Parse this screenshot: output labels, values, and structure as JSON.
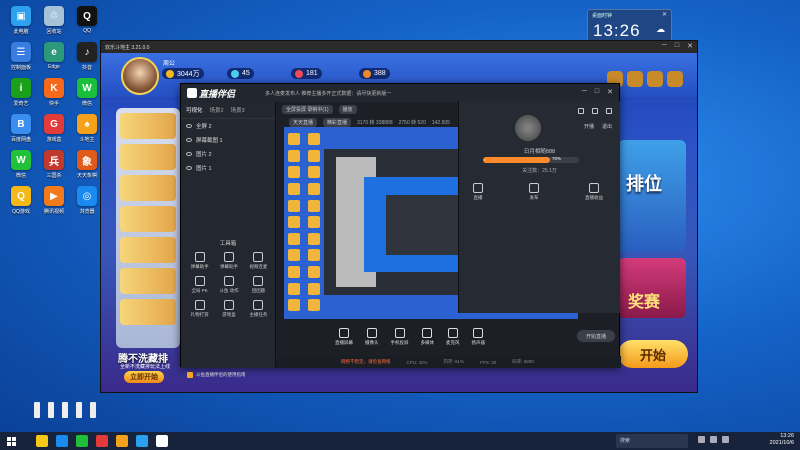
{
  "desktop": {
    "icons": [
      {
        "label": "此电脑",
        "color": "#2ea0f0",
        "glyph": "▣"
      },
      {
        "label": "回收站",
        "color": "#a6c2d8",
        "glyph": "♲"
      },
      {
        "label": "QQ",
        "color": "#111",
        "glyph": "Q"
      },
      {
        "label": "控制面板",
        "color": "#3a7de0",
        "glyph": "☰"
      },
      {
        "label": "Edge",
        "color": "#2c9a7a",
        "glyph": "e"
      },
      {
        "label": "抖音",
        "color": "#222",
        "glyph": "♪"
      },
      {
        "label": "爱奇艺",
        "color": "#1aa01a",
        "glyph": "i"
      },
      {
        "label": "快手",
        "color": "#f56a1a",
        "glyph": "K"
      },
      {
        "label": "微信",
        "color": "#1abf3a",
        "glyph": "W"
      },
      {
        "label": "百度网盘",
        "color": "#3a8ef0",
        "glyph": "B"
      },
      {
        "label": "游戏盒",
        "color": "#e33a3a",
        "glyph": "G"
      },
      {
        "label": "斗地主",
        "color": "#f5a11a",
        "glyph": "♠"
      },
      {
        "label": "微信",
        "color": "#22c13a",
        "glyph": "W"
      },
      {
        "label": "三国杀",
        "color": "#c0392b",
        "glyph": "兵"
      },
      {
        "label": "天天象棋",
        "color": "#e05a1a",
        "glyph": "象"
      },
      {
        "label": "QQ游戏",
        "color": "#f5b81a",
        "glyph": "Q"
      },
      {
        "label": "腾讯视频",
        "color": "#f27a1a",
        "glyph": "▶"
      },
      {
        "label": "浏览器",
        "color": "#1a8af0",
        "glyph": "◎"
      }
    ],
    "clock_widget": {
      "label": "桌面时钟",
      "time": "13:26",
      "close": "✕"
    }
  },
  "game_window": {
    "title": "欢乐斗地主 3.21.0.0",
    "player_label": "周公",
    "stats": [
      {
        "value": "3044万",
        "color": "#f5b81a"
      },
      {
        "value": "45",
        "color": "#4ad0f0"
      },
      {
        "value": "181",
        "color": "#f04a5a"
      },
      {
        "value": "388",
        "color": "#f08a2a"
      }
    ],
    "promo_title": "腾不洗藏排",
    "promo_sub": "全新不洗藏排玩法上线",
    "promo_button": "立即开始",
    "rank_label": "排位",
    "prize_label": "奖赛",
    "start_label": "开始"
  },
  "obs": {
    "logo": "直播伴侣",
    "notice": "多人连麦发布人 推荐主播多开正式数据：请尽快更新版一",
    "scene_tabs": [
      "可视化",
      "场景2",
      "场景3"
    ],
    "scenes": [
      "全屏 2",
      "屏幕截图 1",
      "图片 2",
      "图片 1"
    ],
    "tools_label": "工具箱",
    "tools": [
      {
        "label": "弹幕助手"
      },
      {
        "label": "弹幕助手"
      },
      {
        "label": "视频连麦"
      },
      {
        "label": "全局 PK"
      },
      {
        "label": "斗鱼 动作"
      },
      {
        "label": "团团题"
      },
      {
        "label": "礼物打赏"
      },
      {
        "label": "游戏盒"
      },
      {
        "label": "主播任务"
      }
    ],
    "tool_banner": "斗鱼直播伴侣的使用指南",
    "main_tabs": [
      "全屏投屏 录制中(1)",
      "播放"
    ],
    "main_tabs2": [
      "天天直播",
      "精彩直播"
    ],
    "stats_nums": [
      "3170 转 338888",
      "2750 转 520",
      "142.505"
    ],
    "right_links": [
      "开播",
      "退出"
    ],
    "host_name": "日月相随888",
    "follow_text": "关注数：25.1万",
    "progress_pct": 0.7,
    "progress_label": "70%",
    "actions": [
      "直播",
      "发布",
      "直播收益"
    ],
    "controls": [
      "直播屏幕",
      "摄像头",
      "手机投屏",
      "多媒体",
      "麦克风",
      "扬声器"
    ],
    "live_button": "开始直播",
    "status_items": [
      "网络不稳定，请检查网络",
      "CPU: 42%",
      "内存: 61%",
      "FPS: 30",
      "码率: 6800"
    ]
  },
  "taskbar": {
    "search_placeholder": "搜索",
    "time": "13:26",
    "date": "2021/10/6",
    "apps": [
      "#f5c81a",
      "#1a8af0",
      "#1fbf3a",
      "#e33a3a",
      "#f5a11a",
      "#2aa1f0",
      "#fff"
    ]
  }
}
